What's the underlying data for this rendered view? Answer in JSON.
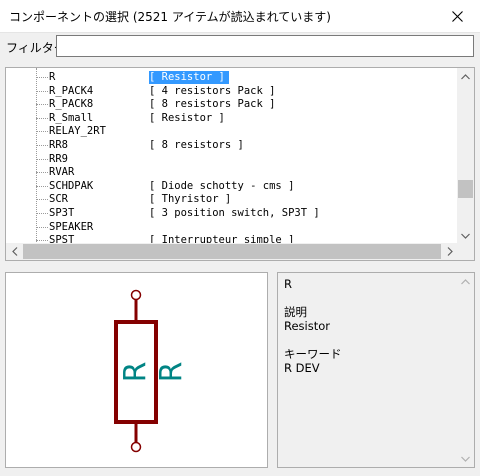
{
  "window": {
    "title": "コンポーネントの選択 (2521 アイテムが読込まれています)"
  },
  "filter": {
    "label": "フィルター:",
    "value": ""
  },
  "components": [
    {
      "name": "R",
      "desc": "[ Resistor ]",
      "selected": true
    },
    {
      "name": "R_PACK4",
      "desc": "[ 4 resistors Pack ]"
    },
    {
      "name": "R_PACK8",
      "desc": "[ 8 resistors Pack ]"
    },
    {
      "name": "R_Small",
      "desc": "[ Resistor ]"
    },
    {
      "name": "RELAY_2RT",
      "desc": ""
    },
    {
      "name": "RR8",
      "desc": "[ 8 resistors ]"
    },
    {
      "name": "RR9",
      "desc": ""
    },
    {
      "name": "RVAR",
      "desc": ""
    },
    {
      "name": "SCHDPAK",
      "desc": "[ Diode schotty - cms ]"
    },
    {
      "name": "SCR",
      "desc": "[ Thyristor ]"
    },
    {
      "name": "SP3T",
      "desc": "[ 3 position switch, SP3T ]"
    },
    {
      "name": "SPEAKER",
      "desc": ""
    },
    {
      "name": "SPST",
      "desc": "[ Interrupteur simple ]"
    }
  ],
  "preview": {
    "symbol_ref": "R",
    "symbol_value": "R",
    "color_body": "#840000",
    "color_text": "#008484"
  },
  "info": {
    "name": "R",
    "desc_heading": "説明",
    "desc_value": "Resistor",
    "keyword_heading": "キーワード",
    "keyword_value": "R DEV"
  },
  "colors": {
    "selection": "#3399ff",
    "scroll_thumb": "#c2c2c2"
  }
}
